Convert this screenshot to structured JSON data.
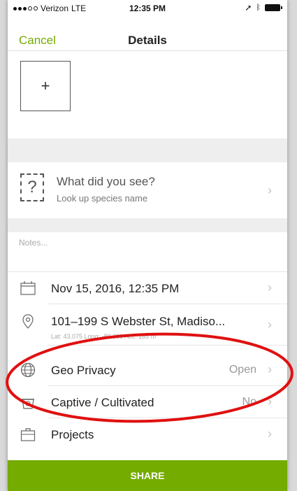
{
  "status_bar": {
    "carrier": "Verizon",
    "network": "LTE",
    "time": "12:35 PM"
  },
  "nav": {
    "cancel_label": "Cancel",
    "title": "Details"
  },
  "photo": {
    "add_symbol": "+"
  },
  "species": {
    "title": "What did you see?",
    "subtitle": "Look up species name",
    "icon_glyph": "?"
  },
  "notes": {
    "placeholder": "Notes..."
  },
  "date_row": {
    "label": "Nov 15, 2016, 12:35 PM",
    "icon": "calendar-icon"
  },
  "location_row": {
    "label": "101–199 S Webster St, Madiso...",
    "sub": "Lat: 43.075  Long: -89.381  Acc: 165 m",
    "icon": "location-pin-icon"
  },
  "geo_privacy_row": {
    "label": "Geo Privacy",
    "value": "Open",
    "icon": "globe-icon"
  },
  "captive_row": {
    "label": "Captive / Cultivated",
    "value": "No",
    "icon": "pot-icon"
  },
  "projects_row": {
    "label": "Projects",
    "icon": "briefcase-icon"
  },
  "share": {
    "label": "SHARE"
  },
  "colors": {
    "accent": "#74ac00",
    "annotation": "#e01010"
  }
}
